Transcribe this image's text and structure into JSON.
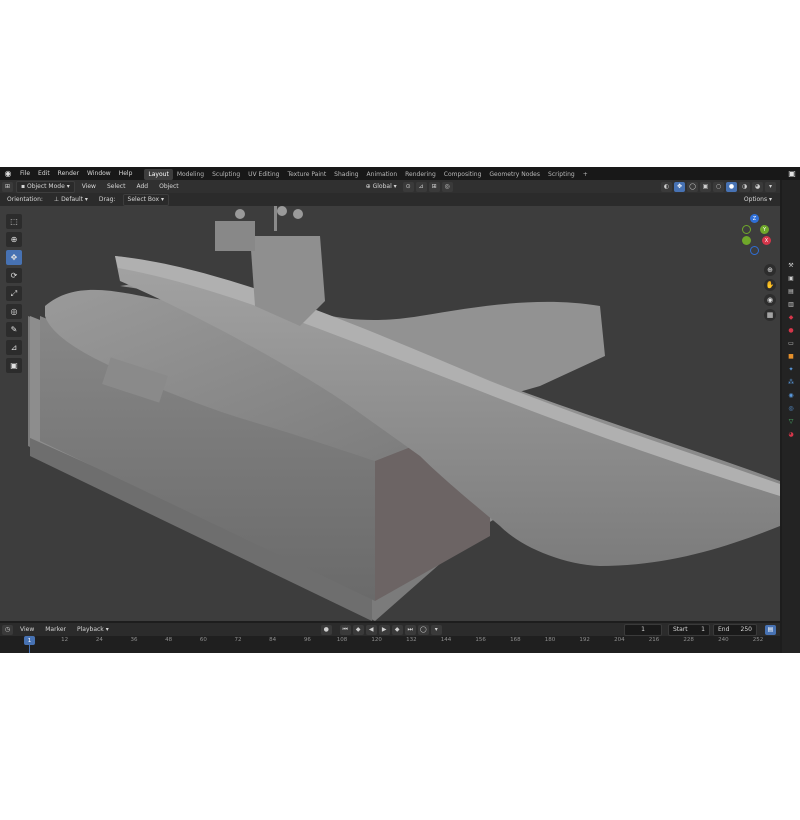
{
  "menubar": {
    "menus": [
      "File",
      "Edit",
      "Render",
      "Window",
      "Help"
    ],
    "workspaces": [
      "Layout",
      "Modeling",
      "Sculpting",
      "UV Editing",
      "Texture Paint",
      "Shading",
      "Animation",
      "Rendering",
      "Compositing",
      "Geometry Nodes",
      "Scripting"
    ],
    "active_workspace": "Layout",
    "add_tab": "+"
  },
  "viewport_header": {
    "mode": "Object Mode",
    "menus": [
      "View",
      "Select",
      "Add",
      "Object"
    ],
    "transform": "Global"
  },
  "tool_settings": {
    "orientation_label": "Orientation:",
    "orientation_value": "Default",
    "drag_label": "Drag:",
    "drag_value": "Select Box",
    "options": "Options"
  },
  "gizmo": {
    "axes": [
      {
        "label": "Z",
        "color": "#2f6fd6"
      },
      {
        "label": "Y",
        "color": "#6fa82a"
      },
      {
        "label": "X",
        "color": "#d5364a"
      }
    ]
  },
  "timeline": {
    "menus": [
      "View",
      "Marker",
      "Playback"
    ],
    "current_frame": "1",
    "start_label": "Start",
    "start_value": "1",
    "end_label": "End",
    "end_value": "250",
    "ticks": [
      "1",
      "12",
      "24",
      "36",
      "48",
      "60",
      "72",
      "84",
      "96",
      "108",
      "120",
      "132",
      "144",
      "156",
      "168",
      "180",
      "192",
      "204",
      "216",
      "228",
      "240",
      "252"
    ]
  },
  "colors": {
    "accent": "#4772b3",
    "viewport_bg": "#3d3d3d",
    "model": "#8c8c8c"
  }
}
